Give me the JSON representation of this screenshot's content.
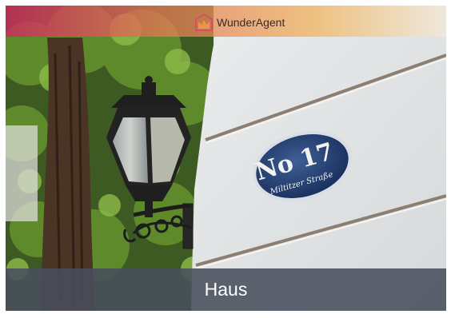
{
  "header": {
    "brand_name": "WunderAgent",
    "logo_icon": "house-crown-logo-icon"
  },
  "photo": {
    "sign_line_1": "No 17",
    "sign_line_2": "Miltitzer Straße"
  },
  "caption": {
    "label": "Haus"
  },
  "colors": {
    "caption_bg": "#484e5c",
    "gradient_start": "#cd285f",
    "gradient_end": "#f4b45a"
  }
}
